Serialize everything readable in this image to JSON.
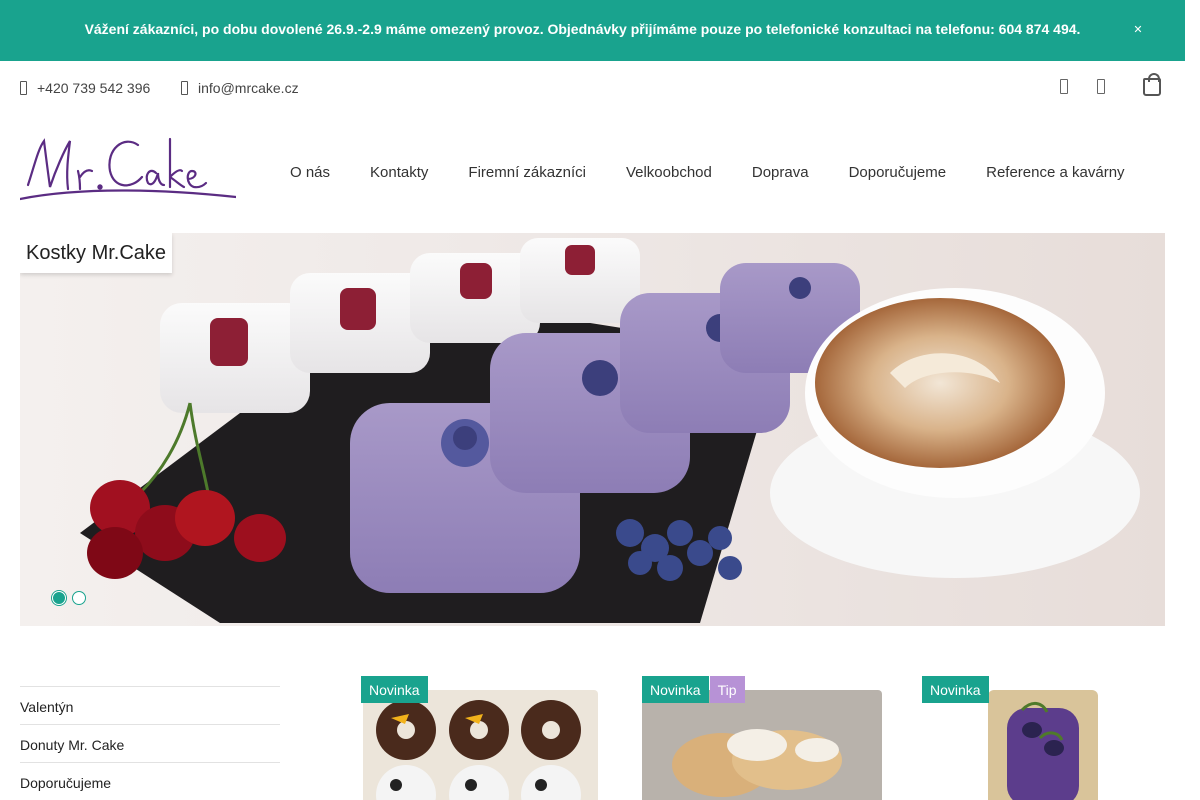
{
  "notice": {
    "text": "Vážení zákazníci, po dobu dovolené 26.9.-2.9 máme omezený provoz. Objednávky přijímáme pouze po telefonické konzultaci na telefonu: 604 874 494.",
    "close_icon": "close-icon"
  },
  "topbar": {
    "phone": "+420 739 542 396",
    "email": "info@mrcake.cz",
    "icons": [
      "phone-icon",
      "mail-icon",
      "user-icon",
      "search-icon",
      "cart-icon"
    ]
  },
  "logo": {
    "text": "Mr. Cake",
    "color": "#5b2c83"
  },
  "nav": [
    "O nás",
    "Kontakty",
    "Firemní zákazníci",
    "Velkoobchod",
    "Doprava",
    "Doporučujeme",
    "Reference a kavárny"
  ],
  "hero": {
    "title": "Kostky Mr.Cake",
    "slides": 2,
    "active_slide": 1
  },
  "sidebar": [
    "Valentýn",
    "Donuty Mr. Cake",
    "Doporučujeme"
  ],
  "products": [
    {
      "badges": [
        "Novinka"
      ]
    },
    {
      "badges": [
        "Novinka",
        "Tip"
      ]
    },
    {
      "badges": [
        "Novinka"
      ]
    }
  ],
  "colors": {
    "accent": "#19a38e",
    "tip": "#b792d6",
    "brand": "#5b2c83"
  }
}
